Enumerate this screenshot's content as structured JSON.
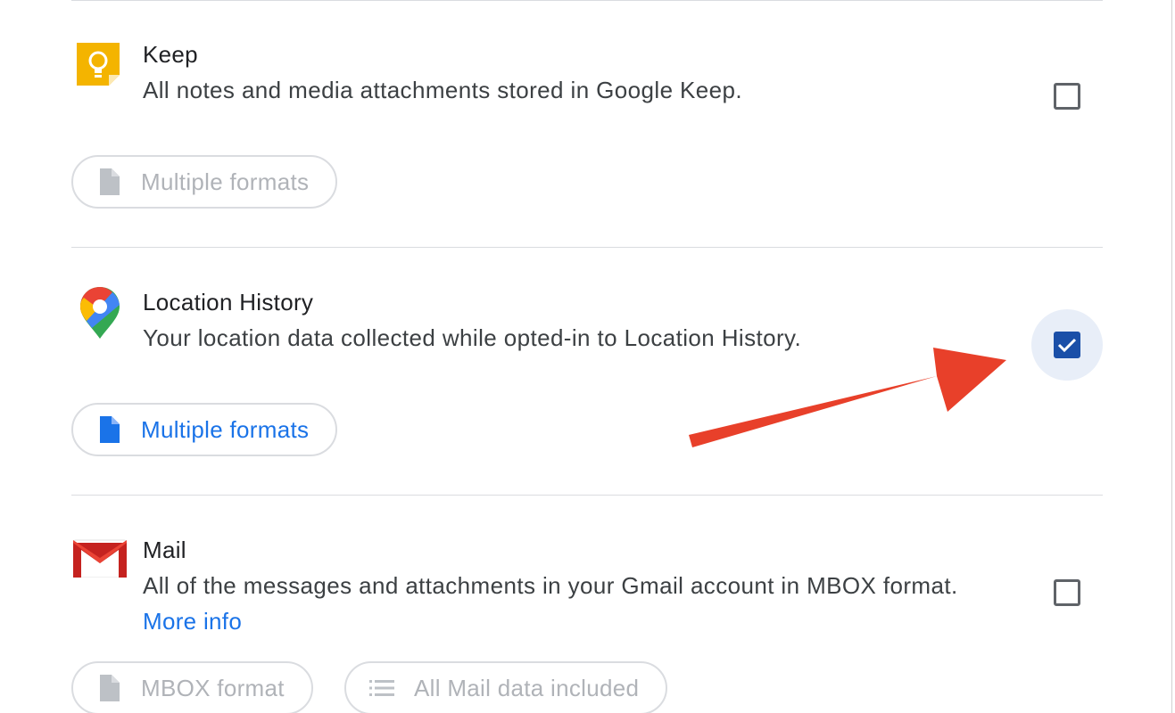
{
  "products": [
    {
      "id": "keep",
      "name": "Keep",
      "description": "All notes and media attachments stored in Google Keep.",
      "checked": false,
      "icon": "google-keep-icon",
      "formats": [
        {
          "label": "Multiple formats",
          "icon": "file-icon",
          "enabled": false
        }
      ]
    },
    {
      "id": "location-history",
      "name": "Location History",
      "description": "Your location data collected while opted-in to Location History.",
      "checked": true,
      "icon": "google-maps-icon",
      "formats": [
        {
          "label": "Multiple formats",
          "icon": "file-icon",
          "enabled": true
        }
      ]
    },
    {
      "id": "mail",
      "name": "Mail",
      "description": "All of the messages and attachments in your Gmail account in MBOX format.",
      "more_info": "More info",
      "checked": false,
      "icon": "gmail-icon",
      "formats": [
        {
          "label": "MBOX format",
          "icon": "file-icon",
          "enabled": false
        },
        {
          "label": "All Mail data included",
          "icon": "list-icon",
          "enabled": false
        }
      ]
    }
  ],
  "annotation": {
    "type": "arrow",
    "color": "#e8402a",
    "points_to": "location-history-checkbox"
  },
  "colors": {
    "accent": "#1a73e8",
    "checkbox_checked": "#1a4fa8",
    "disabled_text": "#b0b3b8"
  }
}
